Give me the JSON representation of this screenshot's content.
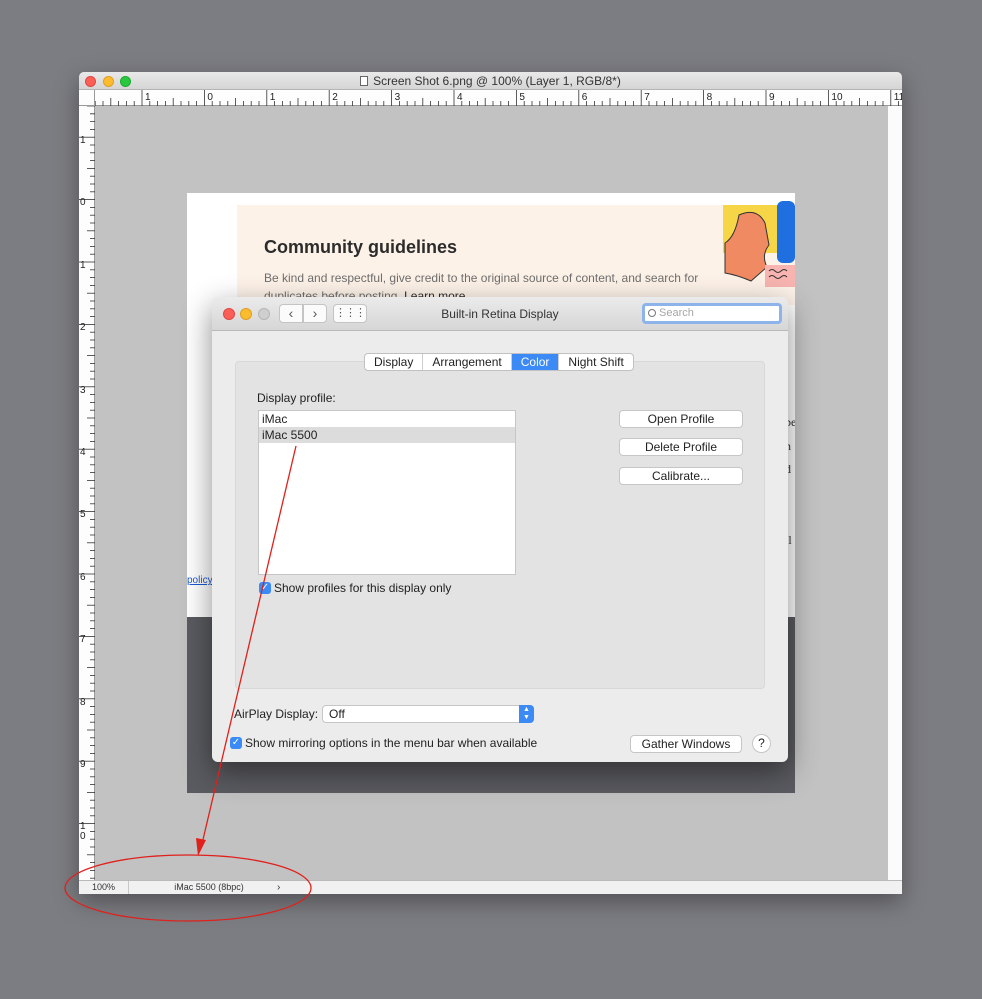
{
  "photoshop": {
    "title": "Screen Shot 6.png @ 100% (Layer 1, RGB/8*)",
    "ruler_top_numbers": [
      "1",
      "0",
      "1",
      "2",
      "3",
      "4",
      "5",
      "6",
      "7",
      "8",
      "9",
      "10",
      "11"
    ],
    "ruler_left_numbers": [
      "1",
      "0",
      "1",
      "2",
      "3",
      "4",
      "5",
      "6",
      "7",
      "8",
      "9",
      "1\n0"
    ],
    "status": {
      "zoom": "100%",
      "profile": "iMac 5500 (8bpc)",
      "arrow": "›"
    }
  },
  "web_page": {
    "banner_title": "Community guidelines",
    "banner_text": "Be kind and respectful, give credit to the original source of content, and search for duplicates before posting.",
    "banner_link": "Learn more",
    "policy_link": "policy",
    "side_fragments": [
      "be",
      "n",
      "d",
      "il"
    ]
  },
  "dialog": {
    "title": "Built-in Retina Display",
    "back_glyph": "‹",
    "forward_glyph": "›",
    "grid_glyph": "⋮⋮⋮",
    "search_placeholder": "Search",
    "tabs": [
      {
        "label": "Display"
      },
      {
        "label": "Arrangement"
      },
      {
        "label": "Color"
      },
      {
        "label": "Night Shift"
      }
    ],
    "display_profile_label": "Display profile:",
    "profiles": [
      "iMac",
      "iMac 5500"
    ],
    "buttons": {
      "open_profile": "Open Profile",
      "delete_profile": "Delete Profile",
      "calibrate": "Calibrate..."
    },
    "show_profiles_label": "Show profiles for this display only",
    "airplay_label": "AirPlay Display:",
    "airplay_value": "Off",
    "mirroring_label": "Show mirroring options in the menu bar when available",
    "gather_windows": "Gather Windows",
    "help": "?",
    "check_glyph": "✓"
  },
  "colors": {
    "accent_blue": "#3b8af6",
    "annotation_red": "#e0201b",
    "banner_bg": "#fdf2e8"
  }
}
